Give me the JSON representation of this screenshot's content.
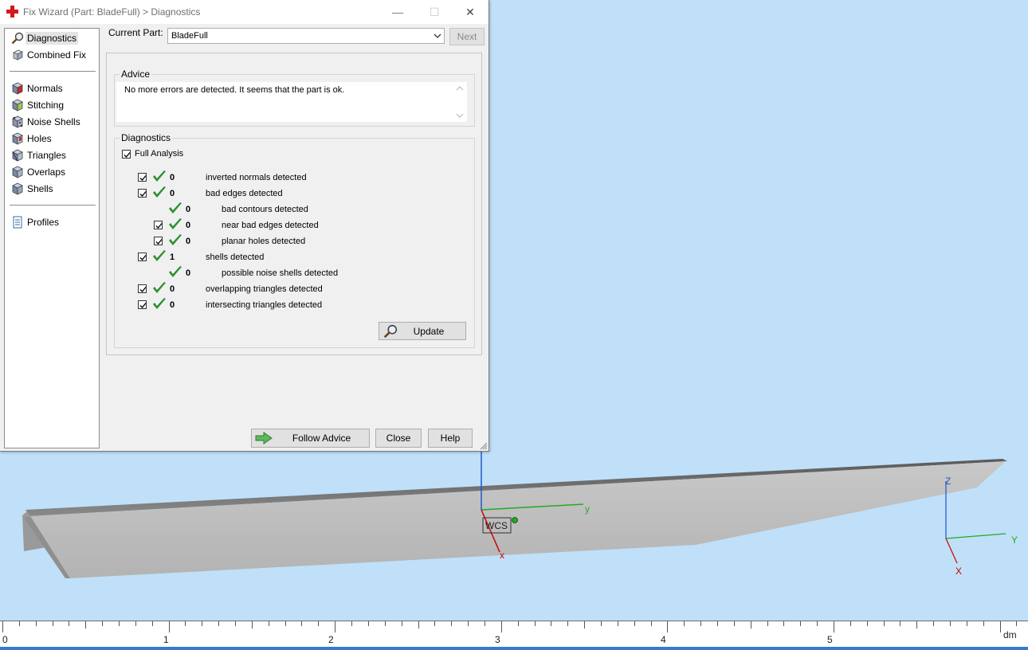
{
  "window": {
    "title": "Fix Wizard (Part: BladeFull) > Diagnostics",
    "minimize": "—",
    "maximize": "☐",
    "close": "✕"
  },
  "nav": {
    "items": [
      {
        "label": "Diagnostics",
        "icon": "magnifier-icon",
        "selected": true
      },
      {
        "label": "Combined Fix",
        "icon": "cube-icon"
      },
      {
        "label": "Normals",
        "icon": "normals-cube-icon"
      },
      {
        "label": "Stitching",
        "icon": "stitching-cube-icon"
      },
      {
        "label": "Noise Shells",
        "icon": "noise-shells-icon"
      },
      {
        "label": "Holes",
        "icon": "holes-cube-icon"
      },
      {
        "label": "Triangles",
        "icon": "triangles-cube-icon"
      },
      {
        "label": "Overlaps",
        "icon": "overlaps-cube-icon"
      },
      {
        "label": "Shells",
        "icon": "shells-cube-icon"
      },
      {
        "label": "Profiles",
        "icon": "document-icon"
      }
    ]
  },
  "toolbar": {
    "current_part_label": "Current Part:",
    "current_part_value": "BladeFull",
    "next_label": "Next"
  },
  "advice": {
    "title": "Advice",
    "text": "No more errors are detected. It seems that the part is ok."
  },
  "diagnostics": {
    "title": "Diagnostics",
    "full_analysis_label": "Full Analysis",
    "full_analysis_checked": true,
    "rows": [
      {
        "count": "0",
        "label": "inverted normals detected",
        "checkbox": true
      },
      {
        "count": "0",
        "label": "bad edges detected",
        "checkbox": true
      },
      {
        "count": "0",
        "label": "bad contours detected",
        "checkbox": false
      },
      {
        "count": "0",
        "label": "near bad edges detected",
        "checkbox": true
      },
      {
        "count": "0",
        "label": "planar holes detected",
        "checkbox": true
      },
      {
        "count": "1",
        "label": "shells detected",
        "checkbox": true
      },
      {
        "count": "0",
        "label": "possible noise shells detected",
        "checkbox": false
      },
      {
        "count": "0",
        "label": "overlapping triangles detected",
        "checkbox": true
      },
      {
        "count": "0",
        "label": "intersecting triangles detected",
        "checkbox": true
      }
    ],
    "update_label": "Update"
  },
  "buttons": {
    "follow_advice": "Follow Advice",
    "close": "Close",
    "help": "Help"
  },
  "viewport": {
    "wcs_label": "WCS",
    "axis_x": "x",
    "axis_y": "y",
    "gizmo_x": "X",
    "gizmo_y": "Y",
    "gizmo_z": "Z"
  },
  "ruler": {
    "labels": [
      "0",
      "1",
      "2",
      "3",
      "4",
      "5"
    ],
    "unit": "dm"
  },
  "colors": {
    "viewport_bg": "#bfe0f8",
    "check_green": "#2f8f2f",
    "axis_red": "#cc0000",
    "axis_green": "#22aa22",
    "axis_blue": "#2255cc"
  }
}
